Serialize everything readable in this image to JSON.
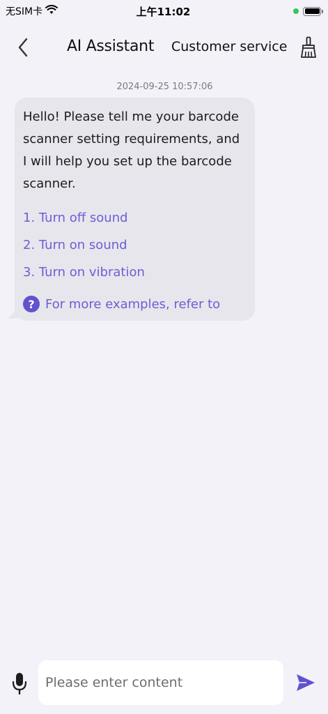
{
  "status_bar": {
    "carrier": "无SIM卡",
    "time": "上午11:02"
  },
  "nav": {
    "title": "AI Assistant",
    "customer_service": "Customer service"
  },
  "chat": {
    "timestamp": "2024-09-25 10:57:06",
    "message": "Hello! Please tell me your barcode scanner setting requirements, and I will help you set up the barcode scanner.",
    "options": [
      "1. Turn off sound",
      "2. Turn on sound",
      "3. Turn on vibration"
    ],
    "more_examples": "For more examples, refer to"
  },
  "input": {
    "placeholder": "Please enter content"
  },
  "colors": {
    "accent": "#6b5fd4",
    "bubble": "#e7e6ec",
    "background": "#f3f2f8"
  },
  "icons": [
    "back-chevron-icon",
    "broom-icon",
    "question-icon",
    "microphone-icon",
    "send-icon",
    "wifi-icon",
    "battery-icon"
  ]
}
